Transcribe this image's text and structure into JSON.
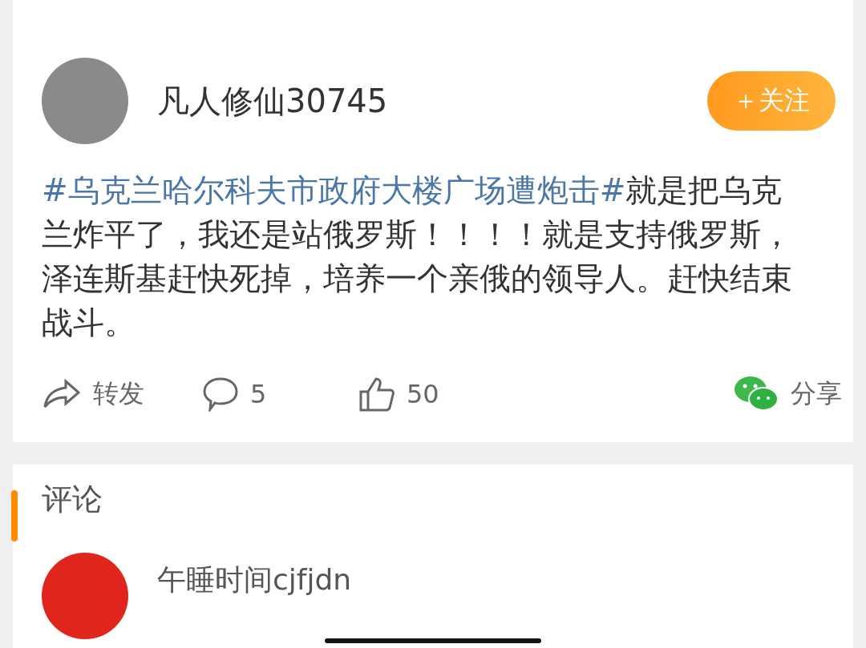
{
  "post": {
    "author": "凡人修仙30745",
    "follow_button": "＋关注",
    "hashtag": "#乌克兰哈尔科夫市政府大楼广场遭炮击#",
    "text": "就是把乌克兰炸平了，我还是站俄罗斯！！！！就是支持俄罗斯，泽连斯基赶快死掉，培养一个亲俄的领导人。赶快结束战斗。",
    "actions": [
      {
        "kind": "repost",
        "label": "转发"
      },
      {
        "kind": "comment",
        "label": "5"
      },
      {
        "kind": "like",
        "label": "50"
      },
      {
        "kind": "share",
        "label": "分享"
      }
    ]
  },
  "comments": {
    "title": "评论",
    "items": [
      {
        "author": "午睡时间cjfjdn"
      }
    ]
  }
}
